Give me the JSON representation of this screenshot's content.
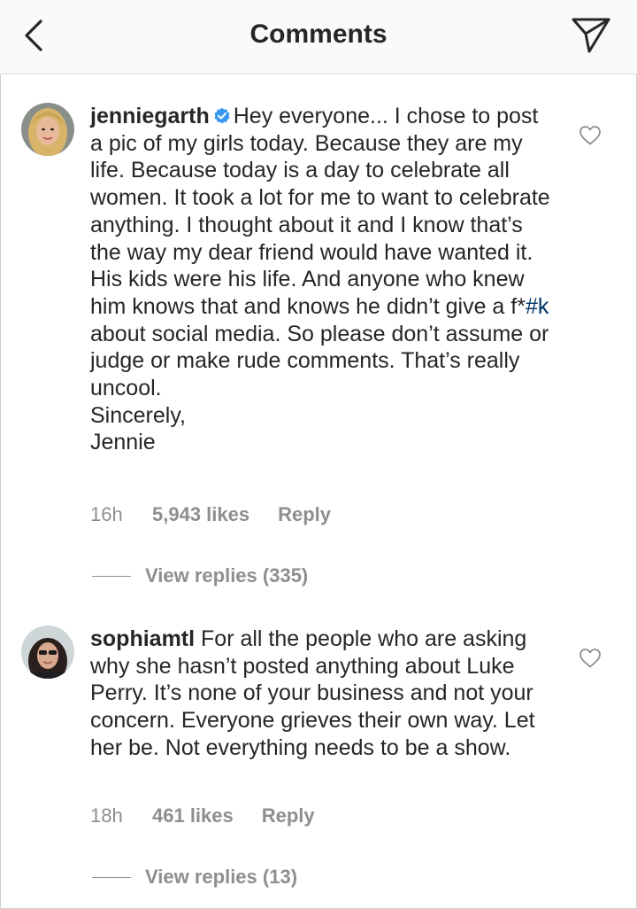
{
  "header": {
    "title": "Comments",
    "back_icon": "chevron-left-icon",
    "share_icon": "paper-plane-icon"
  },
  "comments": [
    {
      "username": "jenniegarth",
      "verified": true,
      "text_before_tag": "Hey everyone... I chose to post a pic of my girls today. Because they are my life. Because today is a day to celebrate all women. It took a lot for me to want to celebrate anything. I thought about it and I know that’s the way my dear friend would have wanted it. His kids were his life. And anyone who knew him knows that and knows he didn’t give a f*",
      "hashtag": "#k",
      "text_after_tag": " about social media.  So please don’t assume or judge or make rude comments. That’s really uncool.",
      "signoff_1": "Sincerely,",
      "signoff_2": "Jennie",
      "time": "16h",
      "likes": "5,943 likes",
      "reply_label": "Reply",
      "view_replies": "View replies (335)"
    },
    {
      "username": "sophiamtl",
      "verified": false,
      "text": "For all the people who are asking why she hasn’t posted anything about Luke Perry. It’s none of your business and not your concern. Everyone grieves their own way. Let her be. Not everything needs to be a show.",
      "time": "18h",
      "likes": "461 likes",
      "reply_label": "Reply",
      "view_replies": "View replies (13)"
    }
  ],
  "colors": {
    "text": "#262626",
    "secondary": "#8e8e8e",
    "hashtag": "#003569",
    "verified": "#3897f0",
    "header_bg": "#fafafa"
  }
}
